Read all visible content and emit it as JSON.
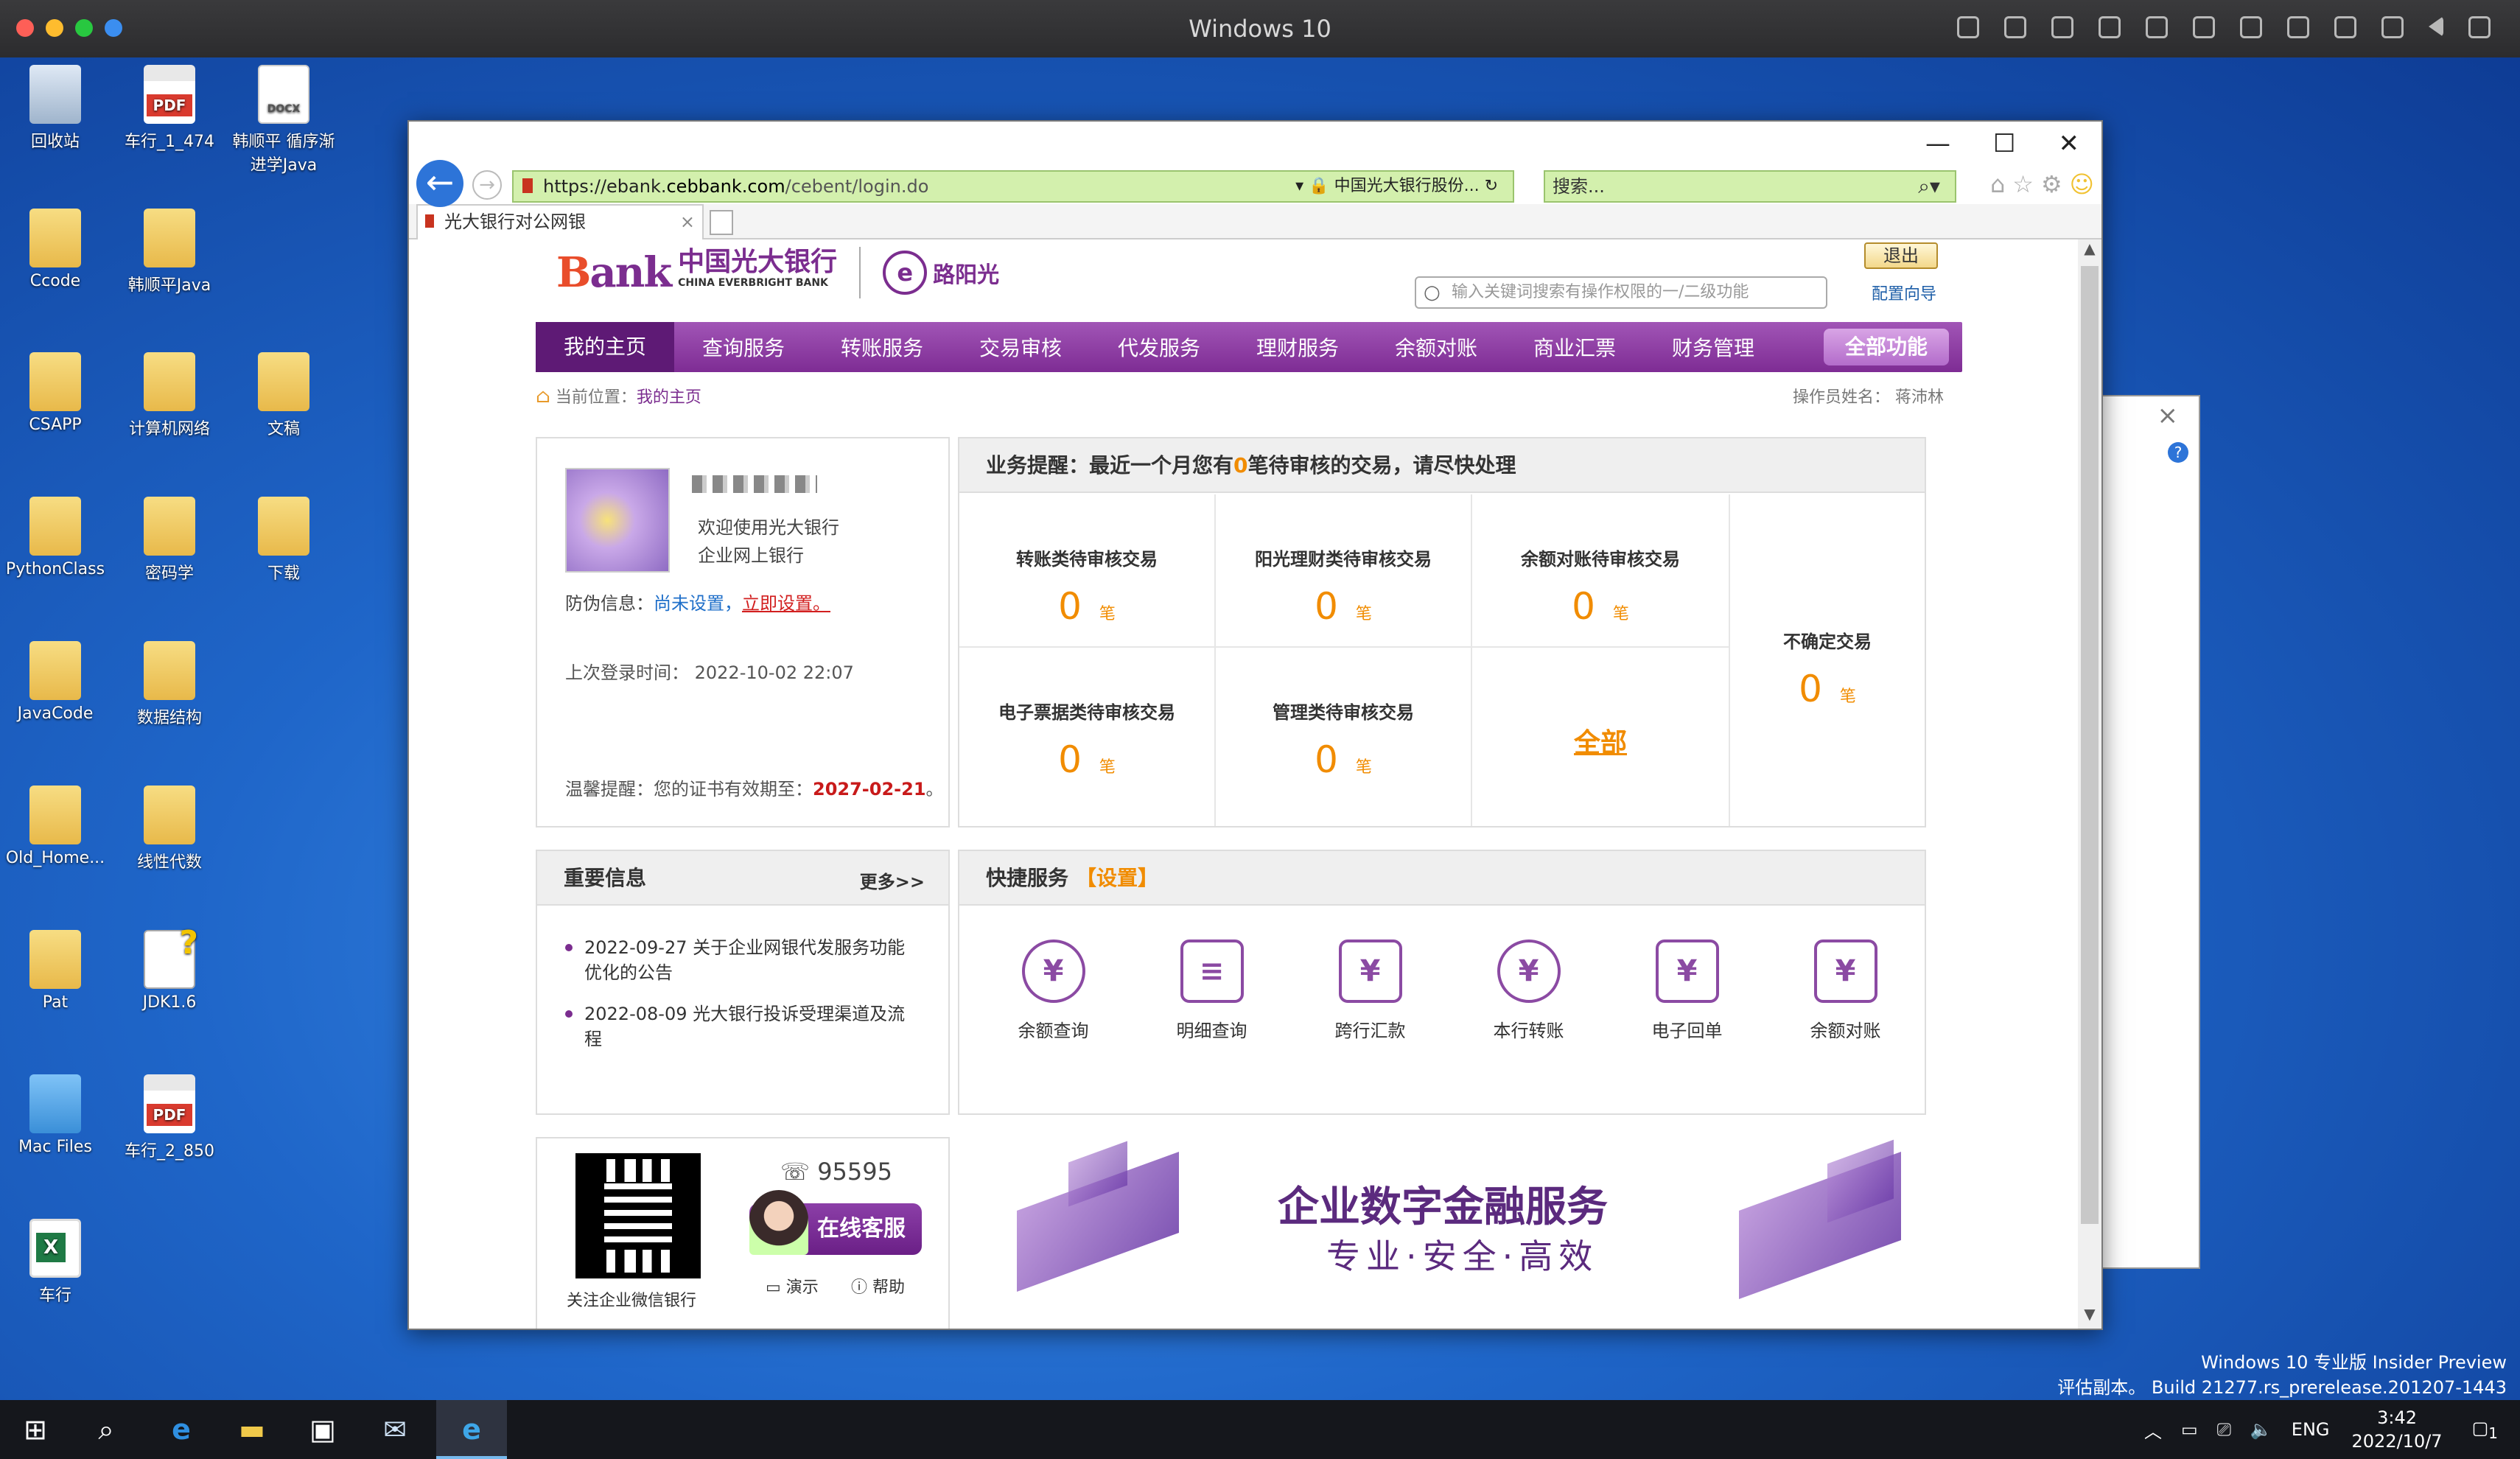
{
  "mac": {
    "title": "Windows 10"
  },
  "desktop_icons": [
    {
      "label": "回收站",
      "icon": "recycle-bin-icon"
    },
    {
      "label": "车行_1_474",
      "icon": "pdf-file-icon",
      "badge": "PDF"
    },
    {
      "label": "韩顺平 循序渐进学Java",
      "icon": "docx-file-icon",
      "badge": "DOCX"
    },
    {
      "label": "Ccode",
      "icon": "folder-icon"
    },
    {
      "label": "韩顺平Java",
      "icon": "folder-icon"
    },
    {
      "label": "CSAPP",
      "icon": "folder-icon"
    },
    {
      "label": "计算机网络",
      "icon": "folder-icon"
    },
    {
      "label": "文稿",
      "icon": "folder-shortcut-icon"
    },
    {
      "label": "PythonClass",
      "icon": "folder-icon"
    },
    {
      "label": "密码学",
      "icon": "folder-icon"
    },
    {
      "label": "下载",
      "icon": "folder-shortcut-icon"
    },
    {
      "label": "JavaCode",
      "icon": "folder-icon"
    },
    {
      "label": "数据结构",
      "icon": "folder-icon"
    },
    {
      "label": "Old_Home...",
      "icon": "folder-icon"
    },
    {
      "label": "线性代数",
      "icon": "folder-icon"
    },
    {
      "label": "Pat",
      "icon": "folder-icon"
    },
    {
      "label": "JDK1.6",
      "icon": "jdk-icon"
    },
    {
      "label": "Mac Files",
      "icon": "mac-folder-icon"
    },
    {
      "label": "车行_2_850",
      "icon": "pdf-file-icon",
      "badge": "PDF"
    },
    {
      "label": "车行",
      "icon": "excel-file-icon",
      "badge": "X"
    }
  ],
  "browser": {
    "url_prefix": "https://ebank.",
    "url_host": "cebbank.com",
    "url_path": "/cebent/login.do",
    "site_identity": "中国光大银行股份...",
    "search_placeholder": "搜索...",
    "tab_title": "光大银行对公网银"
  },
  "bank": {
    "logo_bank": "Bank",
    "logo_cn": "中国光大银行",
    "logo_en": "CHINA EVERBRIGHT BANK",
    "logo_badge": "e",
    "logo_sub": "路阳光",
    "function_search_placeholder": "输入关键词搜索有操作权限的一/二级功能",
    "logout": "退出",
    "config_guide": "配置向导",
    "nav": [
      "我的主页",
      "查询服务",
      "转账服务",
      "交易审核",
      "代发服务",
      "理财服务",
      "余额对账",
      "商业汇票",
      "财务管理"
    ],
    "nav_all": "全部功能",
    "breadcrumb_prefix": "当前位置：",
    "breadcrumb_page": "我的主页",
    "operator": "操作员姓名：  蒋沛林"
  },
  "profile": {
    "welcome_line1": "欢迎使用光大银行",
    "welcome_line2": "企业网上银行",
    "anti_label": "防伪信息：",
    "anti_status": "尚未设置，",
    "anti_action": "立即设置。",
    "last_login": "上次登录时间：  2022-10-02 22:07",
    "warm_tip": "温馨提醒：您的证书有效期至：",
    "cert_date": "2027-02-21",
    "cert_end": "。"
  },
  "business": {
    "title_prefix": "业务提醒：最近一个月您有",
    "title_count": "0",
    "title_suffix": "笔待审核的交易，请尽快处理",
    "unit": "笔",
    "cells": [
      {
        "label": "转账类待审核交易",
        "value": "0"
      },
      {
        "label": "阳光理财类待审核交易",
        "value": "0"
      },
      {
        "label": "余额对账待审核交易",
        "value": "0"
      },
      {
        "label": "电子票据类待审核交易",
        "value": "0"
      },
      {
        "label": "管理类待审核交易",
        "value": "0"
      }
    ],
    "all_link": "全部",
    "uncertain_label": "不确定交易",
    "uncertain_value": "0"
  },
  "news": {
    "title": "重要信息",
    "more": "更多>>",
    "items": [
      "2022-09-27 关于企业网银代发服务功能优化的公告",
      "2022-08-09 光大银行投诉受理渠道及流程"
    ]
  },
  "quick": {
    "title": "快捷服务",
    "settings": "【设置】",
    "items": [
      {
        "label": "余额查询",
        "icon": "balance-query-icon",
        "glyph": "¥"
      },
      {
        "label": "明细查询",
        "icon": "detail-query-icon",
        "glyph": "≡"
      },
      {
        "label": "跨行汇款",
        "icon": "interbank-transfer-icon",
        "glyph": "¥"
      },
      {
        "label": "本行转账",
        "icon": "intrabank-transfer-icon",
        "glyph": "¥"
      },
      {
        "label": "电子回单",
        "icon": "e-receipt-icon",
        "glyph": "¥"
      },
      {
        "label": "余额对账",
        "icon": "balance-reconcile-icon",
        "glyph": "¥"
      }
    ]
  },
  "contact": {
    "qr_label": "关注企业微信银行",
    "hotline": "95595",
    "online_service": "在线客服",
    "demo": "演示",
    "help": "帮助"
  },
  "banner": {
    "headline": "企业数字金融服务",
    "subline": "专业·安全·高效"
  },
  "windows": {
    "edition": "Windows 10 专业版 Insider Preview",
    "build": "评估副本。 Build 21277.rs_prerelease.201207-1443",
    "lang": "ENG",
    "time": "3:42",
    "date": "2022/10/7",
    "notif_count": "1"
  },
  "colors": {
    "brand_purple": "#7e2c94",
    "accent_orange": "#f18c00",
    "address_green": "#d3f0ad"
  }
}
